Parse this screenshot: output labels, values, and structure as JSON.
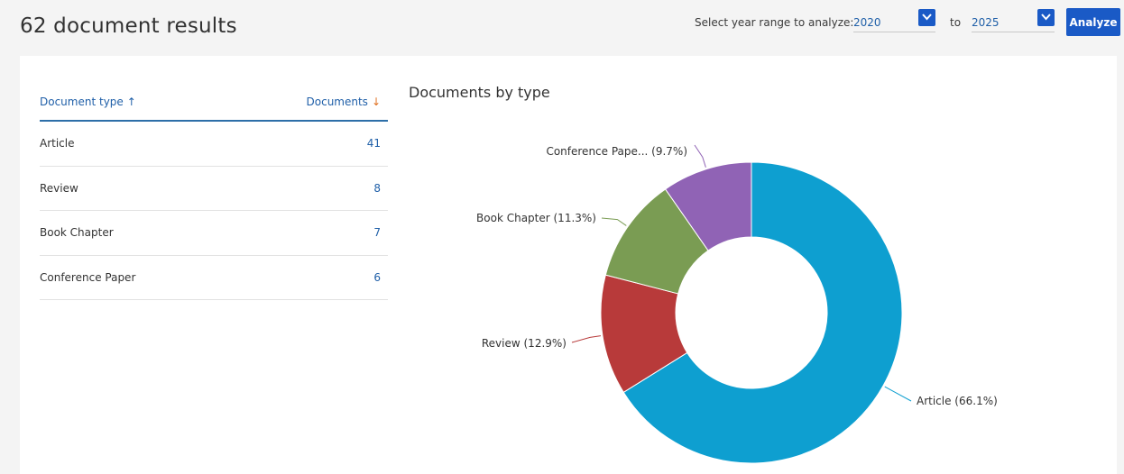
{
  "header": {
    "results_title": "62 document results",
    "year_label": "Select year range to analyze:",
    "year_from": "2020",
    "to_label": "to",
    "year_to": "2025",
    "analyze_label": "Analyze",
    "accent_color": "#1a5ac6"
  },
  "table": {
    "col_type": "Document type",
    "col_docs": "Documents",
    "sort_up_icon": "arrow-up-icon",
    "sort_down_icon": "arrow-down-icon",
    "rows": [
      {
        "type": "Article",
        "count": "41"
      },
      {
        "type": "Review",
        "count": "8"
      },
      {
        "type": "Book Chapter",
        "count": "7"
      },
      {
        "type": "Conference Paper",
        "count": "6"
      }
    ]
  },
  "chart_data": {
    "type": "pie",
    "title": "Documents by type",
    "categories": [
      "Article",
      "Review",
      "Book Chapter",
      "Conference Paper"
    ],
    "values": [
      41,
      8,
      7,
      6
    ],
    "labels": [
      "Article (66.1%)",
      "Review (12.9%)",
      "Book Chapter (11.3%)",
      "Conference Pape... (9.7%)"
    ],
    "colors": [
      "#0e9fd0",
      "#b83a3a",
      "#7a9c53",
      "#9063b5"
    ],
    "donut": true
  }
}
